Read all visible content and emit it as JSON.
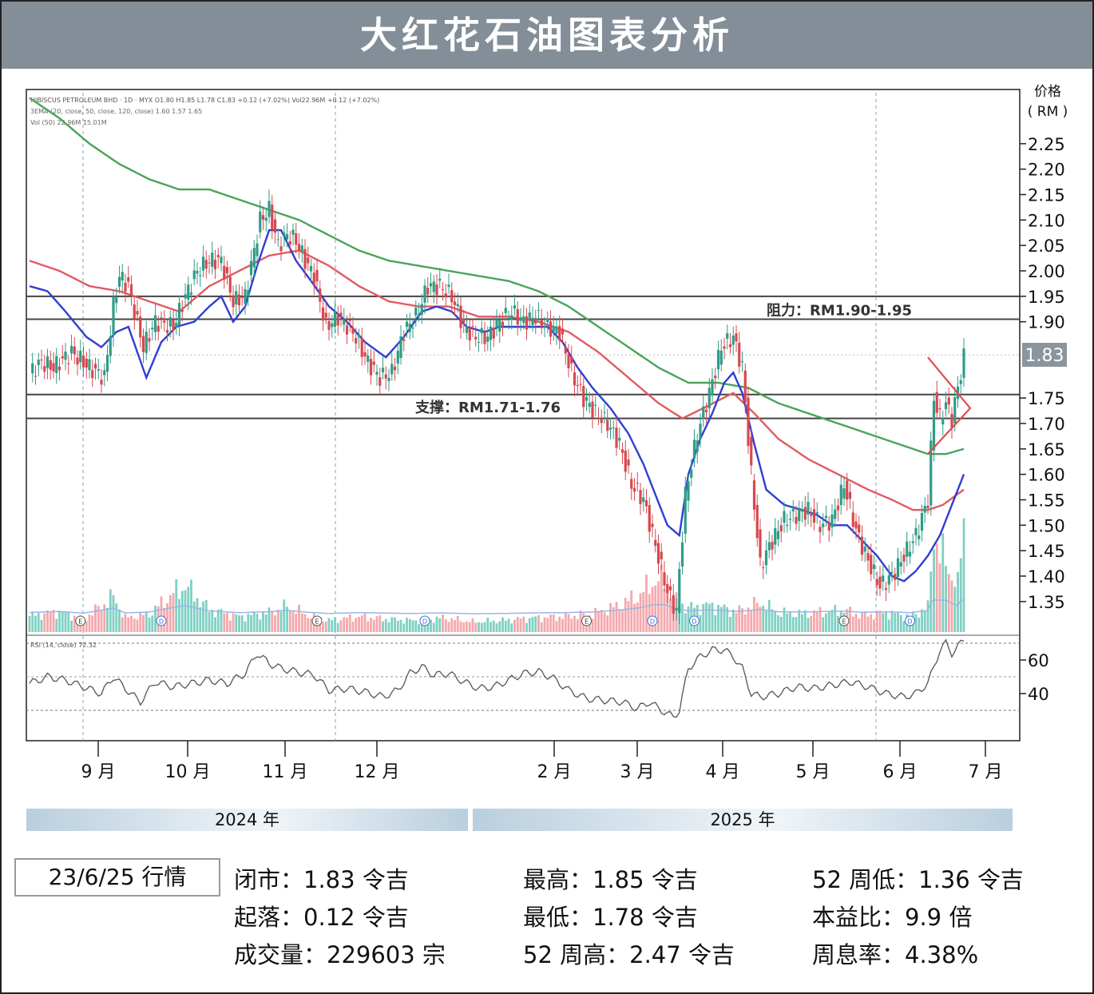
{
  "title": "大红花石油图表分析",
  "chart_data": {
    "type": "candlestick",
    "header_lines": [
      "HIBISCUS PETROLEUM BHD · 1D · MYX  O1.80 H1.85 L1.78 C1.83 +0.12 (+7.02%)  Vol22.96M +0.12 (+7.02%)",
      "3EMA (20, close, 50, close, 120, close)  1.60  1.57  1.65",
      "Vol (50)  22.96M  15.01M"
    ],
    "rsi_label": "RSI (14, close)  72.32",
    "y_axis_title": [
      "价格",
      "( RM )"
    ],
    "ylim": [
      1.29,
      2.3
    ],
    "y_ticks": [
      "2.25",
      "2.20",
      "2.15",
      "2.10",
      "2.05",
      "2.00",
      "1.95",
      "1.90",
      "1.75",
      "1.70",
      "1.65",
      "1.60",
      "1.55",
      "1.50",
      "1.45",
      "1.40",
      "1.35"
    ],
    "rsi_ticks": [
      "60",
      "40"
    ],
    "x_tick_labels": [
      "9 月",
      "10 月",
      "11 月",
      "12 月",
      "2 月",
      "3 月",
      "4 月",
      "5 月",
      "6 月",
      "7 月"
    ],
    "years": [
      "2024 年",
      "2025 年"
    ],
    "last_price_label": "1.83",
    "resistance": {
      "label": "阻力：RM1.90-1.95",
      "low": 1.905,
      "high": 1.95
    },
    "support": {
      "label": "支撑：RM1.71-1.76",
      "low": 1.71,
      "high": 1.757
    },
    "price_anchors": [
      [
        0,
        1.8
      ],
      [
        4,
        1.82
      ],
      [
        8,
        1.81
      ],
      [
        14,
        1.84
      ],
      [
        20,
        1.81
      ],
      [
        25,
        1.79
      ],
      [
        28,
        1.93
      ],
      [
        30,
        1.99
      ],
      [
        33,
        1.97
      ],
      [
        38,
        1.85
      ],
      [
        42,
        1.9
      ],
      [
        48,
        1.89
      ],
      [
        52,
        1.95
      ],
      [
        56,
        2.0
      ],
      [
        60,
        2.02
      ],
      [
        64,
        2.02
      ],
      [
        68,
        1.94
      ],
      [
        72,
        1.95
      ],
      [
        77,
        2.1
      ],
      [
        80,
        2.12
      ],
      [
        83,
        2.05
      ],
      [
        86,
        2.07
      ],
      [
        89,
        2.06
      ],
      [
        92,
        2.02
      ],
      [
        95,
        1.99
      ],
      [
        99,
        1.89
      ],
      [
        103,
        1.91
      ],
      [
        108,
        1.88
      ],
      [
        113,
        1.82
      ],
      [
        117,
        1.79
      ],
      [
        121,
        1.8
      ],
      [
        125,
        1.88
      ],
      [
        129,
        1.91
      ],
      [
        133,
        1.97
      ],
      [
        137,
        1.97
      ],
      [
        141,
        1.95
      ],
      [
        145,
        1.89
      ],
      [
        149,
        1.87
      ],
      [
        153,
        1.87
      ],
      [
        157,
        1.9
      ],
      [
        161,
        1.92
      ],
      [
        165,
        1.9
      ],
      [
        169,
        1.91
      ],
      [
        173,
        1.89
      ],
      [
        177,
        1.88
      ],
      [
        181,
        1.8
      ],
      [
        185,
        1.75
      ],
      [
        189,
        1.72
      ],
      [
        193,
        1.7
      ],
      [
        197,
        1.66
      ],
      [
        201,
        1.58
      ],
      [
        205,
        1.55
      ],
      [
        209,
        1.46
      ],
      [
        213,
        1.37
      ],
      [
        216,
        1.33
      ],
      [
        219,
        1.56
      ],
      [
        223,
        1.68
      ],
      [
        227,
        1.76
      ],
      [
        231,
        1.85
      ],
      [
        235,
        1.87
      ],
      [
        238,
        1.81
      ],
      [
        241,
        1.6
      ],
      [
        244,
        1.42
      ],
      [
        248,
        1.47
      ],
      [
        252,
        1.51
      ],
      [
        256,
        1.52
      ],
      [
        260,
        1.53
      ],
      [
        264,
        1.5
      ],
      [
        268,
        1.51
      ],
      [
        272,
        1.58
      ],
      [
        276,
        1.49
      ],
      [
        280,
        1.43
      ],
      [
        284,
        1.38
      ],
      [
        288,
        1.4
      ],
      [
        292,
        1.44
      ],
      [
        296,
        1.48
      ],
      [
        300,
        1.55
      ],
      [
        302,
        1.75
      ],
      [
        304,
        1.71
      ],
      [
        306,
        1.74
      ],
      [
        308,
        1.71
      ],
      [
        312,
        1.83
      ]
    ],
    "ema20_anchors": [
      [
        0,
        1.97
      ],
      [
        6,
        1.96
      ],
      [
        12,
        1.92
      ],
      [
        19,
        1.87
      ],
      [
        24,
        1.85
      ],
      [
        29,
        1.88
      ],
      [
        33,
        1.89
      ],
      [
        39,
        1.79
      ],
      [
        44,
        1.86
      ],
      [
        49,
        1.89
      ],
      [
        55,
        1.9
      ],
      [
        60,
        1.93
      ],
      [
        64,
        1.95
      ],
      [
        68,
        1.9
      ],
      [
        72,
        1.93
      ],
      [
        76,
        2.01
      ],
      [
        80,
        2.08
      ],
      [
        84,
        2.08
      ],
      [
        89,
        2.02
      ],
      [
        94,
        1.98
      ],
      [
        100,
        1.93
      ],
      [
        106,
        1.9
      ],
      [
        112,
        1.86
      ],
      [
        119,
        1.83
      ],
      [
        125,
        1.87
      ],
      [
        131,
        1.92
      ],
      [
        136,
        1.93
      ],
      [
        141,
        1.92
      ],
      [
        146,
        1.89
      ],
      [
        152,
        1.88
      ],
      [
        157,
        1.89
      ],
      [
        163,
        1.89
      ],
      [
        168,
        1.89
      ],
      [
        173,
        1.89
      ],
      [
        178,
        1.86
      ],
      [
        183,
        1.81
      ],
      [
        188,
        1.77
      ],
      [
        194,
        1.73
      ],
      [
        200,
        1.68
      ],
      [
        205,
        1.62
      ],
      [
        209,
        1.56
      ],
      [
        213,
        1.5
      ],
      [
        217,
        1.48
      ],
      [
        220,
        1.6
      ],
      [
        224,
        1.67
      ],
      [
        228,
        1.72
      ],
      [
        232,
        1.78
      ],
      [
        235,
        1.8
      ],
      [
        238,
        1.76
      ],
      [
        242,
        1.66
      ],
      [
        246,
        1.57
      ],
      [
        252,
        1.54
      ],
      [
        258,
        1.53
      ],
      [
        263,
        1.52
      ],
      [
        268,
        1.5
      ],
      [
        273,
        1.5
      ],
      [
        278,
        1.47
      ],
      [
        283,
        1.44
      ],
      [
        288,
        1.4
      ],
      [
        292,
        1.39
      ],
      [
        296,
        1.41
      ],
      [
        300,
        1.44
      ],
      [
        304,
        1.48
      ],
      [
        308,
        1.54
      ],
      [
        312,
        1.6
      ]
    ],
    "ema50_anchors": [
      [
        0,
        2.02
      ],
      [
        10,
        2.0
      ],
      [
        20,
        1.97
      ],
      [
        30,
        1.96
      ],
      [
        40,
        1.94
      ],
      [
        50,
        1.92
      ],
      [
        60,
        1.97
      ],
      [
        70,
        2.0
      ],
      [
        80,
        2.03
      ],
      [
        90,
        2.04
      ],
      [
        100,
        2.01
      ],
      [
        110,
        1.97
      ],
      [
        120,
        1.94
      ],
      [
        130,
        1.93
      ],
      [
        140,
        1.93
      ],
      [
        150,
        1.91
      ],
      [
        160,
        1.91
      ],
      [
        170,
        1.9
      ],
      [
        180,
        1.88
      ],
      [
        190,
        1.84
      ],
      [
        200,
        1.79
      ],
      [
        210,
        1.74
      ],
      [
        218,
        1.71
      ],
      [
        225,
        1.73
      ],
      [
        235,
        1.76
      ],
      [
        242,
        1.72
      ],
      [
        250,
        1.67
      ],
      [
        260,
        1.63
      ],
      [
        270,
        1.6
      ],
      [
        280,
        1.57
      ],
      [
        288,
        1.55
      ],
      [
        295,
        1.53
      ],
      [
        300,
        1.53
      ],
      [
        305,
        1.54
      ],
      [
        312,
        1.57
      ]
    ],
    "ema120_anchors": [
      [
        0,
        2.34
      ],
      [
        10,
        2.3
      ],
      [
        20,
        2.25
      ],
      [
        30,
        2.21
      ],
      [
        40,
        2.18
      ],
      [
        50,
        2.16
      ],
      [
        60,
        2.16
      ],
      [
        70,
        2.14
      ],
      [
        80,
        2.12
      ],
      [
        90,
        2.1
      ],
      [
        100,
        2.07
      ],
      [
        110,
        2.04
      ],
      [
        120,
        2.02
      ],
      [
        130,
        2.01
      ],
      [
        140,
        2.0
      ],
      [
        150,
        1.99
      ],
      [
        160,
        1.98
      ],
      [
        170,
        1.96
      ],
      [
        180,
        1.93
      ],
      [
        190,
        1.89
      ],
      [
        200,
        1.85
      ],
      [
        210,
        1.81
      ],
      [
        220,
        1.78
      ],
      [
        230,
        1.78
      ],
      [
        240,
        1.77
      ],
      [
        250,
        1.74
      ],
      [
        260,
        1.72
      ],
      [
        270,
        1.7
      ],
      [
        280,
        1.68
      ],
      [
        290,
        1.66
      ],
      [
        300,
        1.64
      ],
      [
        306,
        1.64
      ],
      [
        312,
        1.65
      ]
    ],
    "rsi_anchors": [
      [
        0,
        46
      ],
      [
        6,
        50
      ],
      [
        12,
        48
      ],
      [
        18,
        44
      ],
      [
        24,
        40
      ],
      [
        28,
        50
      ],
      [
        32,
        43
      ],
      [
        37,
        35
      ],
      [
        42,
        47
      ],
      [
        48,
        44
      ],
      [
        54,
        46
      ],
      [
        60,
        48
      ],
      [
        66,
        46
      ],
      [
        72,
        52
      ],
      [
        76,
        64
      ],
      [
        80,
        58
      ],
      [
        84,
        55
      ],
      [
        89,
        53
      ],
      [
        95,
        51
      ],
      [
        100,
        42
      ],
      [
        106,
        43
      ],
      [
        112,
        41
      ],
      [
        118,
        38
      ],
      [
        123,
        42
      ],
      [
        127,
        52
      ],
      [
        131,
        56
      ],
      [
        135,
        51
      ],
      [
        140,
        52
      ],
      [
        145,
        47
      ],
      [
        150,
        43
      ],
      [
        155,
        44
      ],
      [
        160,
        48
      ],
      [
        165,
        52
      ],
      [
        170,
        53
      ],
      [
        175,
        49
      ],
      [
        180,
        42
      ],
      [
        186,
        37
      ],
      [
        192,
        36
      ],
      [
        198,
        35
      ],
      [
        203,
        31
      ],
      [
        207,
        35
      ],
      [
        211,
        30
      ],
      [
        215,
        26
      ],
      [
        217,
        30
      ],
      [
        220,
        55
      ],
      [
        224,
        62
      ],
      [
        228,
        66
      ],
      [
        232,
        66
      ],
      [
        235,
        62
      ],
      [
        238,
        55
      ],
      [
        241,
        40
      ],
      [
        244,
        38
      ],
      [
        250,
        40
      ],
      [
        256,
        44
      ],
      [
        262,
        43
      ],
      [
        268,
        45
      ],
      [
        274,
        47
      ],
      [
        280,
        44
      ],
      [
        286,
        40
      ],
      [
        292,
        38
      ],
      [
        296,
        40
      ],
      [
        300,
        46
      ],
      [
        304,
        66
      ],
      [
        306,
        70
      ],
      [
        308,
        64
      ],
      [
        312,
        72
      ]
    ],
    "volume_anchors": [
      [
        0,
        25
      ],
      [
        10,
        32
      ],
      [
        18,
        20
      ],
      [
        28,
        55
      ],
      [
        32,
        22
      ],
      [
        40,
        28
      ],
      [
        48,
        60
      ],
      [
        52,
        72
      ],
      [
        60,
        35
      ],
      [
        70,
        24
      ],
      [
        80,
        30
      ],
      [
        86,
        40
      ],
      [
        93,
        26
      ],
      [
        100,
        18
      ],
      [
        110,
        24
      ],
      [
        120,
        20
      ],
      [
        128,
        18
      ],
      [
        138,
        22
      ],
      [
        148,
        16
      ],
      [
        158,
        18
      ],
      [
        168,
        22
      ],
      [
        178,
        24
      ],
      [
        188,
        28
      ],
      [
        196,
        40
      ],
      [
        204,
        58
      ],
      [
        208,
        78
      ],
      [
        212,
        80
      ],
      [
        216,
        48
      ],
      [
        220,
        38
      ],
      [
        228,
        42
      ],
      [
        236,
        32
      ],
      [
        240,
        38
      ],
      [
        244,
        46
      ],
      [
        250,
        30
      ],
      [
        258,
        28
      ],
      [
        266,
        32
      ],
      [
        272,
        34
      ],
      [
        278,
        26
      ],
      [
        286,
        30
      ],
      [
        294,
        24
      ],
      [
        300,
        38
      ],
      [
        302,
        160
      ],
      [
        304,
        120
      ],
      [
        306,
        110
      ],
      [
        308,
        90
      ],
      [
        310,
        70
      ],
      [
        312,
        175
      ]
    ],
    "dividend_markers": [
      [
        17,
        "E"
      ],
      [
        44,
        "D"
      ],
      [
        96,
        "E"
      ],
      [
        132,
        "D"
      ],
      [
        186,
        "E"
      ],
      [
        208,
        "D"
      ],
      [
        222,
        "D"
      ],
      [
        272,
        "E"
      ],
      [
        294,
        "D"
      ]
    ]
  },
  "footer": {
    "date": "23/6/25 行情",
    "close": "闭市：1.83 令吉",
    "change": "起落：0.12 令吉",
    "volume": "成交量：229603 宗",
    "high": "最高：1.85 令吉",
    "low": "最低：1.78 令吉",
    "high52": "52 周高：2.47 令吉",
    "low52": "52 周低：1.36 令吉",
    "pe": "本益比：9.9 倍",
    "dy": "周息率：4.38%"
  }
}
